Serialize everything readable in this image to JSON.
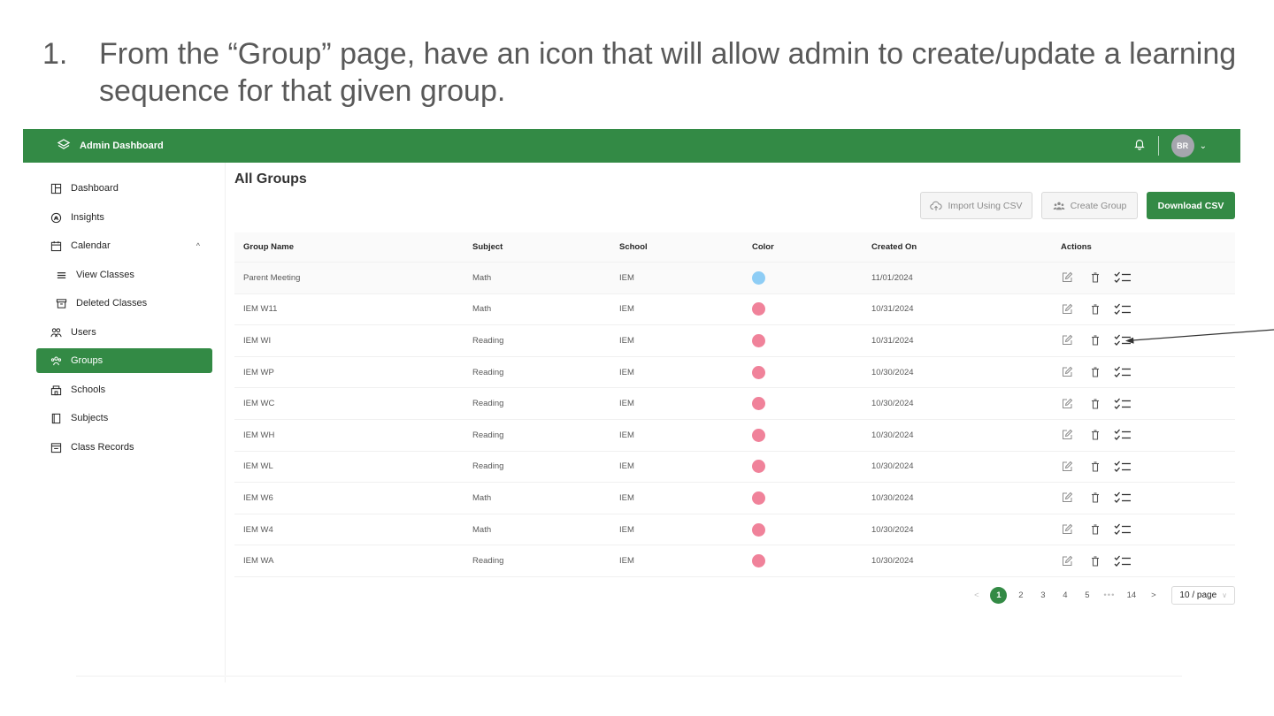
{
  "slide": {
    "number": "1.",
    "heading": "From the “Group” page, have an icon that will allow admin to create/update a learning sequence for that given group."
  },
  "header": {
    "brand": "Admin Dashboard",
    "brand_icon": "layers-icon",
    "bell_icon": "bell-icon",
    "avatar_initials": "BR",
    "avatar_chevron": "⌄",
    "bg_color": "#338a45"
  },
  "sidebar": {
    "items": [
      {
        "label": "Dashboard",
        "icon": "dashboard-icon"
      },
      {
        "label": "Insights",
        "icon": "insights-icon"
      },
      {
        "label": "Calendar",
        "icon": "calendar-icon",
        "chevron": "^"
      },
      {
        "label": "View Classes",
        "icon": "list-icon"
      },
      {
        "label": "Deleted Classes",
        "icon": "archive-icon"
      },
      {
        "label": "Users",
        "icon": "users-icon"
      },
      {
        "label": "Groups",
        "icon": "groups-icon",
        "active": true
      },
      {
        "label": "Schools",
        "icon": "school-icon"
      },
      {
        "label": "Subjects",
        "icon": "book-icon"
      },
      {
        "label": "Class Records",
        "icon": "records-icon"
      }
    ]
  },
  "main": {
    "title": "All Groups",
    "buttons": {
      "import": "Import Using CSV",
      "create": "Create Group",
      "download": "Download CSV"
    },
    "columns": [
      "Group Name",
      "Subject",
      "School",
      "Color",
      "Created On",
      "Actions"
    ],
    "rows": [
      {
        "name": "Parent Meeting",
        "subject": "Math",
        "school": "IEM",
        "color": "#8ecdf5",
        "created": "11/01/2024"
      },
      {
        "name": "IEM W11",
        "subject": "Math",
        "school": "IEM",
        "color": "#f0829a",
        "created": "10/31/2024"
      },
      {
        "name": "IEM WI",
        "subject": "Reading",
        "school": "IEM",
        "color": "#f0829a",
        "created": "10/31/2024"
      },
      {
        "name": "IEM WP",
        "subject": "Reading",
        "school": "IEM",
        "color": "#f0829a",
        "created": "10/30/2024"
      },
      {
        "name": "IEM WC",
        "subject": "Reading",
        "school": "IEM",
        "color": "#f0829a",
        "created": "10/30/2024"
      },
      {
        "name": "IEM WH",
        "subject": "Reading",
        "school": "IEM",
        "color": "#f0829a",
        "created": "10/30/2024"
      },
      {
        "name": "IEM WL",
        "subject": "Reading",
        "school": "IEM",
        "color": "#f0829a",
        "created": "10/30/2024"
      },
      {
        "name": "IEM W6",
        "subject": "Math",
        "school": "IEM",
        "color": "#f0829a",
        "created": "10/30/2024"
      },
      {
        "name": "IEM W4",
        "subject": "Math",
        "school": "IEM",
        "color": "#f0829a",
        "created": "10/30/2024"
      },
      {
        "name": "IEM WA",
        "subject": "Reading",
        "school": "IEM",
        "color": "#f0829a",
        "created": "10/30/2024"
      }
    ],
    "action_icons": [
      "edit-icon",
      "delete-icon",
      "learning-sequence-icon"
    ]
  },
  "pagination": {
    "prev": "<",
    "pages": [
      "1",
      "2",
      "3",
      "4",
      "5"
    ],
    "ellipsis": "•••",
    "last": "14",
    "next": ">",
    "current": "1",
    "page_size": "10 / page",
    "page_size_caret": "∨"
  }
}
